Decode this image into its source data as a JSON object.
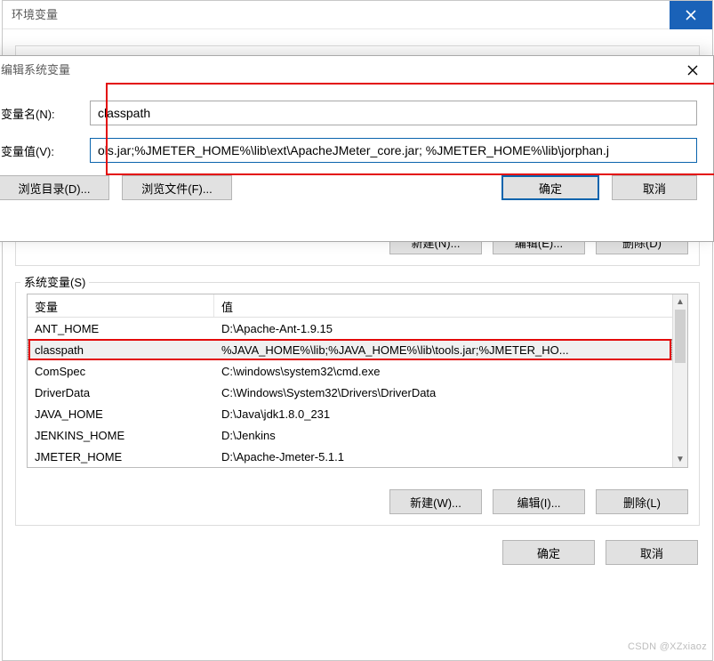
{
  "back": {
    "title": "环境变量",
    "panel_buttons": {
      "new": "新建(N)...",
      "edit": "编辑(E)...",
      "delete": "删除(D)"
    },
    "sysvar_label": "系统变量(S)",
    "columns": {
      "name": "变量",
      "value": "值"
    },
    "rows": [
      {
        "name": "ANT_HOME",
        "value": "D:\\Apache-Ant-1.9.15",
        "selected": false
      },
      {
        "name": "classpath",
        "value": "%JAVA_HOME%\\lib;%JAVA_HOME%\\lib\\tools.jar;%JMETER_HO...",
        "selected": true
      },
      {
        "name": "ComSpec",
        "value": "C:\\windows\\system32\\cmd.exe",
        "selected": false
      },
      {
        "name": "DriverData",
        "value": "C:\\Windows\\System32\\Drivers\\DriverData",
        "selected": false
      },
      {
        "name": "JAVA_HOME",
        "value": "D:\\Java\\jdk1.8.0_231",
        "selected": false
      },
      {
        "name": "JENKINS_HOME",
        "value": "D:\\Jenkins",
        "selected": false
      },
      {
        "name": "JMETER_HOME",
        "value": "D:\\Apache-Jmeter-5.1.1",
        "selected": false
      }
    ],
    "sys_buttons": {
      "new": "新建(W)...",
      "edit": "编辑(I)...",
      "delete": "删除(L)"
    },
    "dialog_buttons": {
      "ok": "确定",
      "cancel": "取消"
    }
  },
  "front": {
    "title": "编辑系统变量",
    "name_label": "变量名(N):",
    "value_label": "变量值(V):",
    "name_value": "classpath",
    "value_value": "ols.jar;%JMETER_HOME%\\lib\\ext\\ApacheJMeter_core.jar; %JMETER_HOME%\\lib\\jorphan.j",
    "buttons": {
      "browse_dir": "浏览目录(D)...",
      "browse_file": "浏览文件(F)...",
      "ok": "确定",
      "cancel": "取消"
    }
  },
  "watermark": "CSDN @XZxiaoz"
}
